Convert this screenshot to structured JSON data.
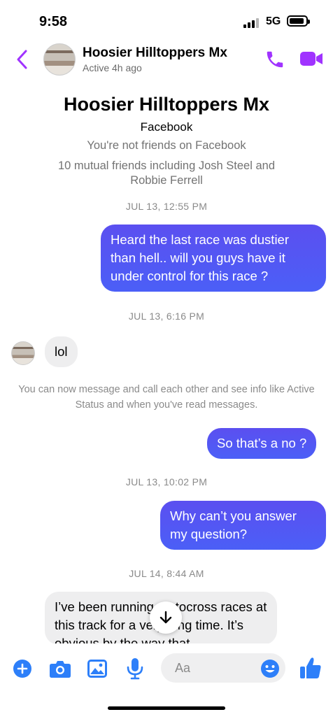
{
  "status_bar": {
    "time": "9:58",
    "network": "5G"
  },
  "header": {
    "title": "Hoosier Hilltoppers Mx",
    "subtitle": "Active 4h ago"
  },
  "profile": {
    "name": "Hoosier Hilltoppers Mx",
    "platform": "Facebook",
    "friend_status": "You're not friends on Facebook",
    "mutual": "10 mutual friends including Josh Steel and Robbie Ferrell"
  },
  "messages": {
    "ts1": "JUL 13, 12:55 PM",
    "m1": "Heard the last race was dustier than hell.. will you guys have it under control for this race ?",
    "ts2": "JUL 13, 6:16 PM",
    "m2": "lol",
    "system_note": "You can now message and call each other and see info like Active Status and when you've read messages.",
    "m3": "So that’s a no ?",
    "ts3": "JUL 13, 10:02 PM",
    "m4": "Why can’t you answer my question?",
    "ts4": "JUL 14, 8:44 AM",
    "m5": "I’ve been running motocross races at this track for a very long time. It’s obvious by the way that"
  },
  "composer": {
    "placeholder": "Aa"
  },
  "colors": {
    "accent": "#a033ff",
    "bubble_out": "#5356f2",
    "icon_blue": "#2d7ff9",
    "bubble_in": "#eeeeef"
  },
  "icons": [
    "chevron-left-icon",
    "phone-icon",
    "video-camera-icon",
    "plus-icon",
    "camera-icon",
    "image-icon",
    "microphone-icon",
    "emoji-icon",
    "thumbs-up-icon",
    "arrow-down-icon"
  ]
}
